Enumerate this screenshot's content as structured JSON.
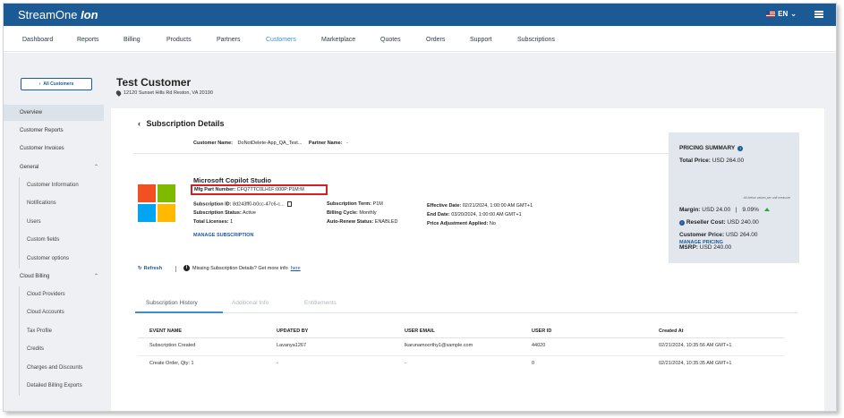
{
  "app": {
    "brand": "StreamOne",
    "product": "Ion",
    "language": "EN"
  },
  "nav": [
    "Dashboard",
    "Reports",
    "Billing",
    "Products",
    "Partners",
    "Customers",
    "Marketplace",
    "Quotes",
    "Orders",
    "Support",
    "Subscriptions"
  ],
  "sidebar": {
    "back_label": "All Customers",
    "items": [
      "Overview",
      "Customer Reports",
      "Customer Invoices",
      "General",
      "Customer Information",
      "Notifications",
      "Users",
      "Custom fields",
      "Customer options",
      "Cloud Billing",
      "Cloud Providers",
      "Cloud Accounts",
      "Tax Profile",
      "Credits",
      "Charges and Discounts",
      "Detailed Billing Exports"
    ]
  },
  "customer": {
    "name": "Test Customer",
    "address": "12120 Sunset Hills Rd Reston, VA 20190"
  },
  "subscription": {
    "title": "Subscription Details",
    "customer_name_label": "Customer Name:",
    "customer_name_value": "DoNotDelete-App_QA_Test...",
    "partner_name_label": "Partner Name:",
    "partner_name_value": "-",
    "product_name": "Microsoft Copilot Studio",
    "mfg_label": "Mfg Part Number:",
    "mfg_value": "CFQ7TTC0LH1F:000P:P1M:M",
    "sub_id_label": "Subscription ID:",
    "sub_id_value": "8d243ff0-b0cc-47c6-c...",
    "status_label": "Subscription Status:",
    "status_value": "Active",
    "licenses_label": "Total Licenses:",
    "licenses_value": "1",
    "term_label": "Subscription Term:",
    "term_value": "P1M",
    "cycle_label": "Billing Cycle:",
    "cycle_value": "Monthly",
    "renew_label": "Auto-Renew Status:",
    "renew_value": "ENABLED",
    "effective_label": "Effective Date:",
    "effective_value": "02/21/2024, 1:00:00 AM GMT+1",
    "end_label": "End Date:",
    "end_value": "03/20/2024, 1:00:00 AM GMT+1",
    "adjust_label": "Price Adjustment Applied:",
    "adjust_value": "No",
    "manage_label": "MANAGE SUBSCRIPTION"
  },
  "pricing": {
    "title": "PRICING SUMMARY",
    "total_label": "Total Price:",
    "total_value": "USD 264.00",
    "note": "All below values per unit measure",
    "margin_label": "Margin:",
    "margin_value": "USD 24.00",
    "margin_pct": "9.09%",
    "reseller_label": "Reseller Cost:",
    "reseller_value": "USD 240.00",
    "customer_price_label": "Customer Price:",
    "customer_price_value": "USD 264.00",
    "msrp_label": "MSRP:",
    "msrp_value": "USD 240.00",
    "manage_label": "MANAGE PRICING",
    "margin_trend_color": "#28a745"
  },
  "refresh_label": "Refresh",
  "missing_text": "Missing Subscription Details? Get more info",
  "missing_link": "here",
  "tabs": [
    "Subscription History",
    "Additional Info",
    "Entitlements"
  ],
  "table": {
    "headers": [
      "EVENT NAME",
      "UPDATED BY",
      "USER EMAIL",
      "USER ID",
      "Created At"
    ],
    "rows": [
      [
        "Subscription Created",
        "Lavanya1267",
        "lkarunamoorthy1@sample.com",
        "44020",
        "02/21/2024, 10:35:56 AM GMT+1"
      ],
      [
        "Create Order, Qty: 1",
        "-",
        "-",
        "0",
        "02/21/2024, 10:35:35 AM GMT+1"
      ]
    ]
  },
  "colors": {
    "brand": "#1c5a96",
    "accent": "#3b8fd0",
    "highlight": "#d21f1f"
  }
}
